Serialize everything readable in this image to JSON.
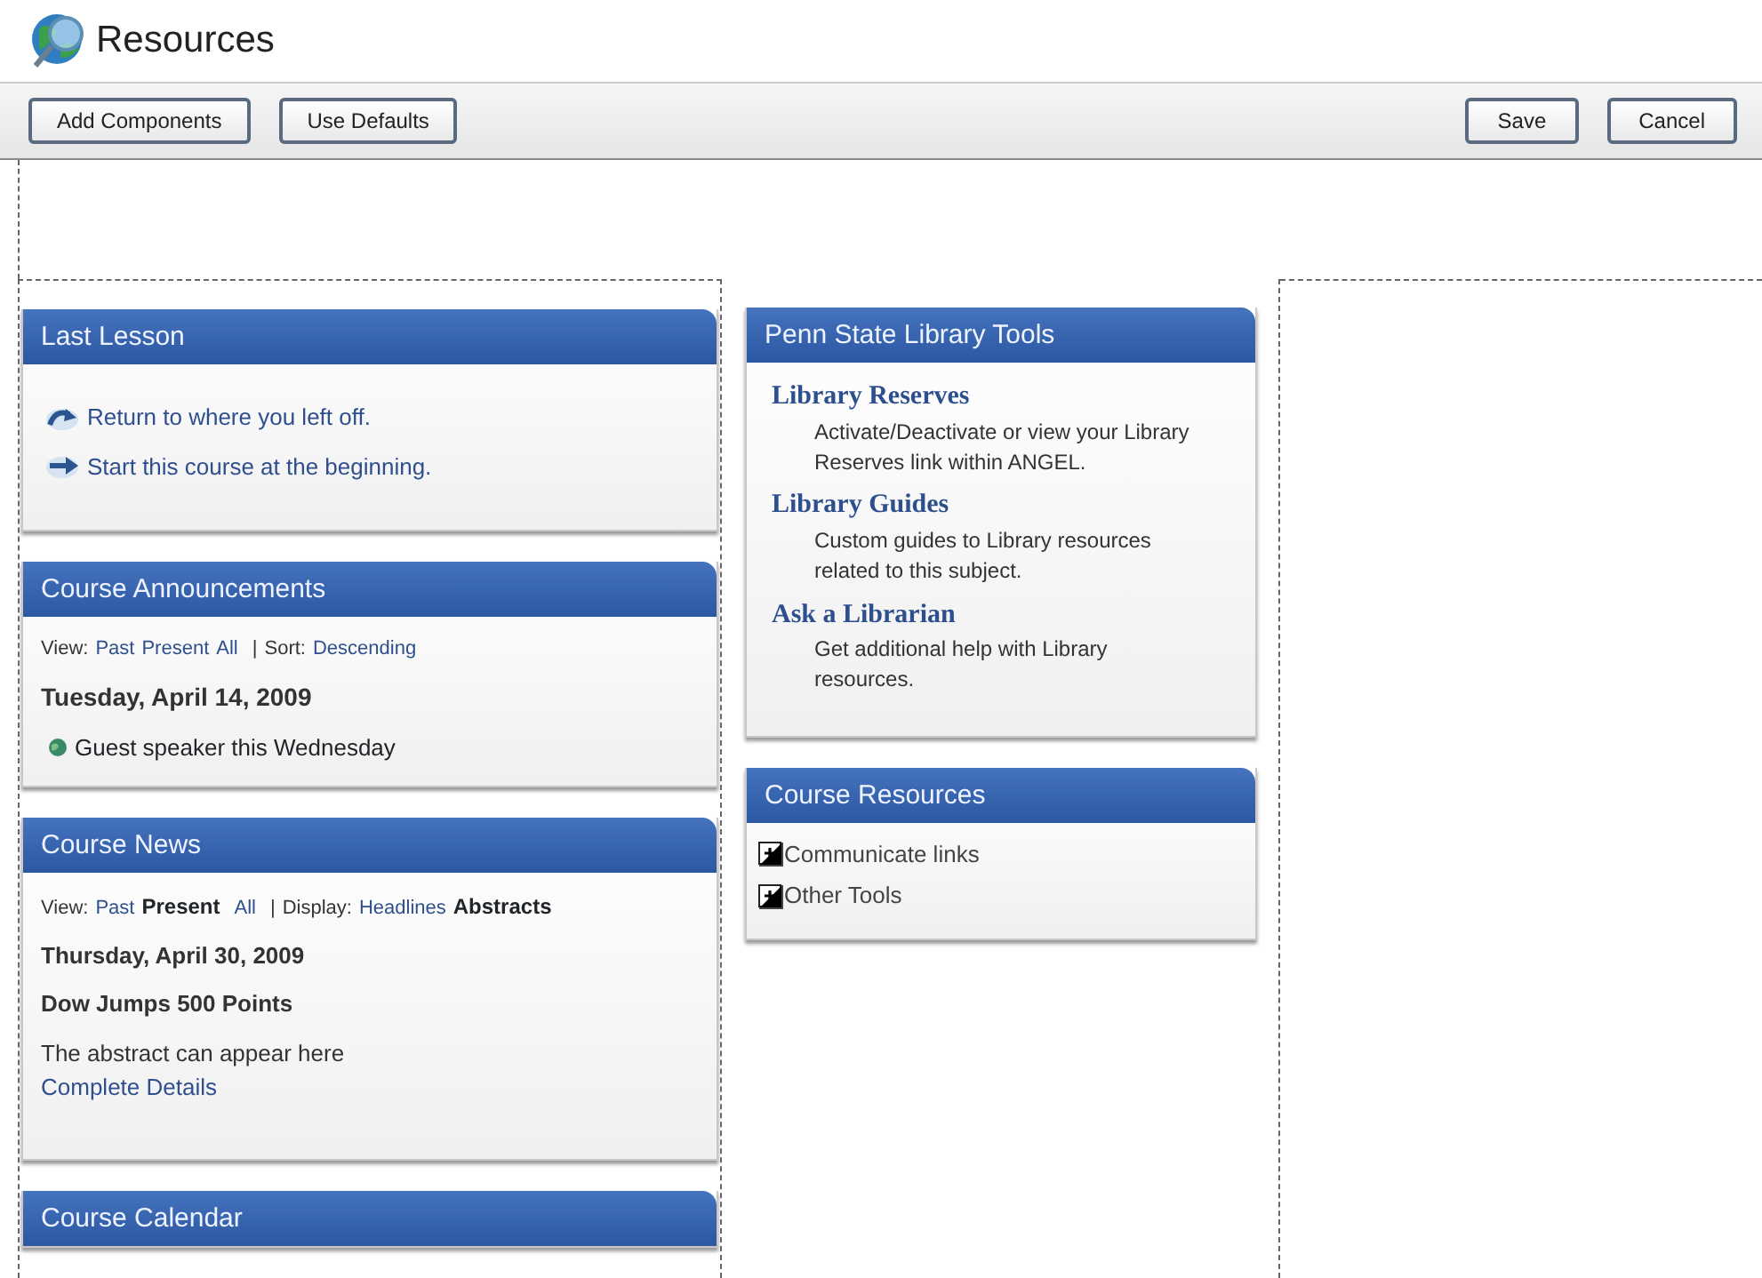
{
  "page": {
    "title": "Resources"
  },
  "toolbar": {
    "left_buttons": [
      "Add Components",
      "Use Defaults"
    ],
    "right_buttons": [
      "Save",
      "Cancel"
    ]
  },
  "columns": [
    {
      "panels": [
        {
          "kind": "links",
          "title": "Last Lesson",
          "links": [
            {
              "kind": "return",
              "label": "Return to where you left off."
            },
            {
              "kind": "start",
              "label": "Start this course at the beginning."
            }
          ]
        },
        {
          "kind": "posts",
          "title": "Course Announcements",
          "separator": "|",
          "groups": [
            {
              "label": "View:",
              "options": [
                {
                  "label": "Past",
                  "selected": false
                },
                {
                  "label": "Present",
                  "selected": false
                },
                {
                  "label": "All",
                  "selected": false
                }
              ]
            },
            {
              "label": "Sort:",
              "options": [
                {
                  "label": "Descending",
                  "selected": false
                }
              ]
            }
          ],
          "date": "Tuesday, April 14, 2009",
          "items": [
            "Guest speaker this Wednesday"
          ]
        },
        {
          "kind": "news",
          "title": "Course News",
          "separator": "|",
          "groups": [
            {
              "label": "View:",
              "options": [
                {
                  "label": "Past",
                  "selected": false
                },
                {
                  "label": "Present",
                  "selected": true
                },
                {
                  "label": "All",
                  "selected": false
                }
              ]
            },
            {
              "label": "Display:",
              "options": [
                {
                  "label": "Headlines",
                  "selected": false
                },
                {
                  "label": "Abstracts",
                  "selected": true
                }
              ]
            }
          ],
          "date": "Thursday, April 30, 2009",
          "headline": "Dow Jumps 500 Points",
          "abstract": "The abstract can appear here",
          "link": "Complete Details"
        },
        {
          "kind": "header_only",
          "title": "Course Calendar"
        }
      ]
    },
    {
      "panels": [
        {
          "kind": "library",
          "title": "Penn State Library Tools",
          "entries": [
            {
              "title": "Library Reserves",
              "description": "Activate/Deactivate or view your Library Reserves link within ANGEL."
            },
            {
              "title": "Library Guides",
              "description": "Custom guides to Library resources related to this subject."
            },
            {
              "title": "Ask a Librarian",
              "description": "Get additional help with Library resources."
            }
          ]
        },
        {
          "kind": "tree",
          "title": "Course Resources",
          "nodes": [
            {
              "label": "Communicate links",
              "expanded": false
            },
            {
              "label": "Other Tools",
              "expanded": false
            }
          ]
        }
      ]
    }
  ]
}
